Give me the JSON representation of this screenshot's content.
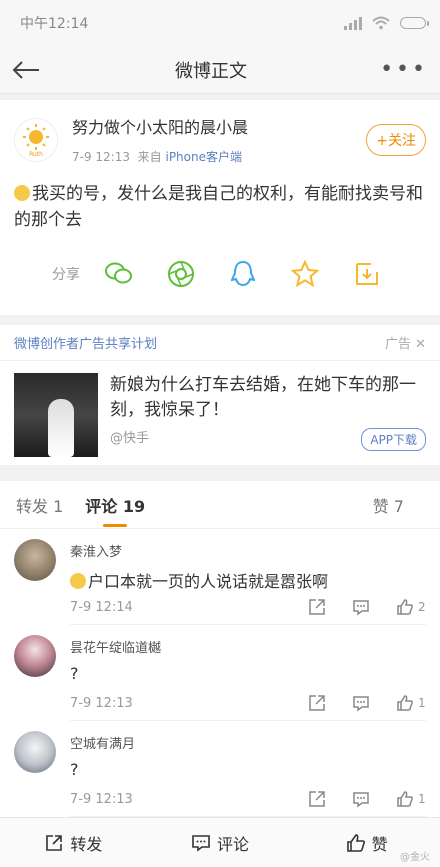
{
  "status": {
    "time": "中午12:14"
  },
  "header": {
    "title": "微博正文"
  },
  "post": {
    "user": "努力做个小太阳的晨小晨",
    "avatar_caption": "Ruth",
    "time": "7-9 12:13",
    "source_prefix": "来自",
    "source": "iPhone客户端",
    "follow_label": "+关注",
    "text": "我买的号，发什么是我自己的权利，有能耐找卖号和的那个去",
    "share_label": "分享",
    "share_icons": [
      "wechat-icon",
      "moments-icon",
      "qq-icon",
      "favorite-star-icon",
      "save-image-icon"
    ]
  },
  "ad": {
    "plan": "微博创作者广告共享计划",
    "tag": "广告",
    "title": "新娘为什么打车去结婚，在她下车的那一刻，我惊呆了！",
    "from": "@快手",
    "button": "APP下载"
  },
  "tabs": {
    "repost": "转发 1",
    "comment": "评论 19",
    "like": "赞 7"
  },
  "comments": [
    {
      "name": "秦淮入梦",
      "text": "户口本就一页的人说话就是嚣张啊",
      "time": "7-9 12:14",
      "likes": "2",
      "emoji": true
    },
    {
      "name": "昙花午绽临道樾",
      "text": "?",
      "time": "7-9 12:13",
      "likes": "1",
      "emoji": false
    },
    {
      "name": "空城有满月",
      "text": "?",
      "time": "7-9 12:13",
      "likes": "1",
      "emoji": false
    }
  ],
  "bottom": {
    "repost": "转发",
    "comment": "评论",
    "like": "赞"
  },
  "watermark": "@金火",
  "colors": {
    "accent": "#f08a00",
    "link": "#5b7fc1"
  }
}
